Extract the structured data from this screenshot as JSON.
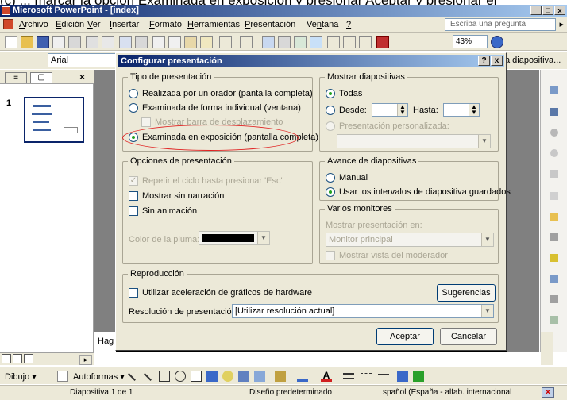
{
  "top_caption": "(c) ... marcar la opción Examinada en exposición y presionar Aceptar y presionar el",
  "window": {
    "title": "Microsoft PowerPoint - [index]",
    "controls": [
      "_",
      "□",
      "x"
    ]
  },
  "menu": {
    "items": [
      {
        "pre": "",
        "u": "A",
        "post": "rchivo"
      },
      {
        "pre": "",
        "u": "E",
        "post": "dición"
      },
      {
        "pre": "",
        "u": "V",
        "post": "er"
      },
      {
        "pre": "",
        "u": "I",
        "post": "nsertar"
      },
      {
        "pre": "",
        "u": "F",
        "post": "ormato"
      },
      {
        "pre": "",
        "u": "H",
        "post": "erramientas"
      },
      {
        "pre": "",
        "u": "P",
        "post": "resentación"
      },
      {
        "pre": "Ve",
        "u": "n",
        "post": "tana"
      },
      {
        "pre": "",
        "u": "?",
        "post": ""
      }
    ],
    "help_placeholder": "Escriba una pregunta"
  },
  "toolbar": {
    "zoom": "43%",
    "font": "Arial",
    "new_slide_label": "a diapositiva..."
  },
  "left_pane": {
    "slide_number": "1",
    "tab_outline": "≡",
    "tab_slides": "▢",
    "close": "×"
  },
  "canvas": {
    "placeholder_text": "Hag"
  },
  "drawbar": {
    "draw_label": "Dibujo ▾",
    "autoshapes_label": "Autoformas ▾"
  },
  "status": {
    "slide": "Diapositiva 1 de 1",
    "design": "Diseño predeterminado",
    "language": "spañol (España - alfab. internacional"
  },
  "dialog": {
    "title": "Configurar presentación",
    "help_btn": "?",
    "close_btn": "x",
    "tipo": {
      "legend": "Tipo de presentación",
      "opt1": "Realizada por un orador (pantalla completa)",
      "opt2": "Examinada de forma individual (ventana)",
      "opt2_sub": "Mostrar barra de desplazamiento",
      "opt3": "Examinada en exposición (pantalla completa)"
    },
    "mostrar": {
      "legend": "Mostrar diapositivas",
      "todas": "Todas",
      "desde": "Desde:",
      "hasta": "Hasta:",
      "personalizada": "Presentación personalizada:"
    },
    "opciones": {
      "legend": "Opciones de presentación",
      "repetir": "Repetir el ciclo hasta presionar 'Esc'",
      "sin_narracion": "Mostrar sin narración",
      "sin_animacion": "Sin animación",
      "color_pluma": "Color de la pluma:"
    },
    "avance": {
      "legend": "Avance de diapositivas",
      "manual": "Manual",
      "intervalos": "Usar los intervalos de diapositiva guardados"
    },
    "monitores": {
      "legend": "Varios monitores",
      "mostrar_en": "Mostrar presentación en:",
      "monitor": "Monitor principal",
      "vista_moderador": "Mostrar vista del moderador"
    },
    "reproduccion": {
      "legend": "Reproducción",
      "aceleracion": "Utilizar aceleración de gráficos de hardware",
      "sugerencias": "Sugerencias",
      "resolucion_label": "Resolución de presentación:",
      "resolucion_value": "[Utilizar resolución actual]"
    },
    "aceptar": "Aceptar",
    "cancelar": "Cancelar"
  },
  "colors": {
    "title_start": "#0a246a",
    "title_end": "#a6caf0",
    "highlight": "#e02020",
    "pen_color": "#000000"
  }
}
